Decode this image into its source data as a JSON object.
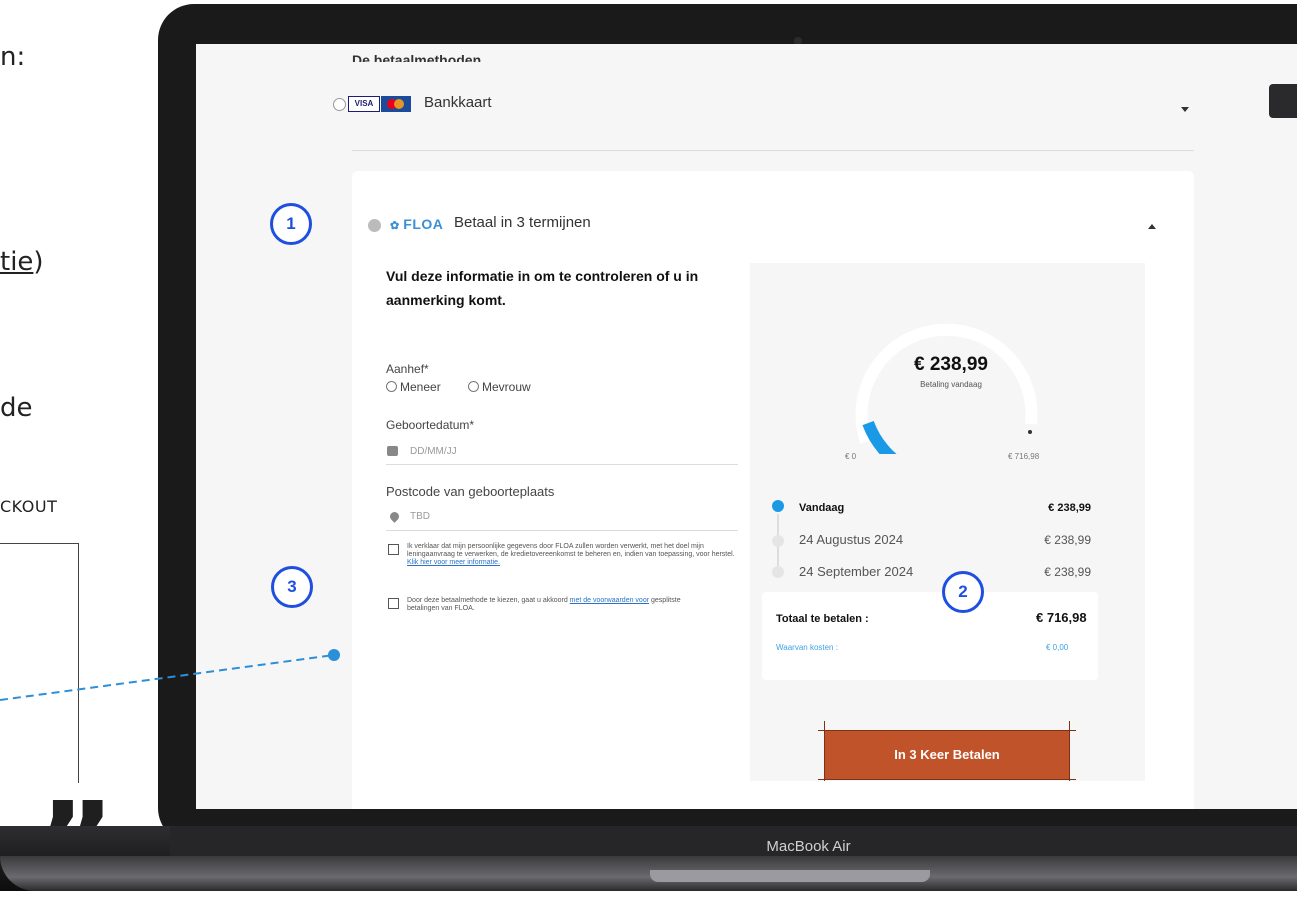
{
  "slide": {
    "line1": "n:",
    "line2_suffix": "tie",
    "line2_paren": ")",
    "line3": "de",
    "line4": "CKOUT",
    "quote": "”"
  },
  "laptop": {
    "model_label": "MacBook Air"
  },
  "checkout": {
    "header_cut": "De betaalmethoden",
    "bank_option": {
      "label": "Bankkaart",
      "visa_label": "VISA"
    },
    "floa_option": {
      "brand": "FLOA",
      "title": "Betaal in 3 termijnen",
      "form": {
        "intro": "Vul deze informatie in om te controleren of u in aanmerking komt.",
        "salutation_label": "Aanhef*",
        "salutation_options": [
          "Meneer",
          "Mevrouw"
        ],
        "birthdate_label": "Geboortedatum*",
        "birthdate_placeholder": "DD/MM/JJ",
        "postcode_label": "Postcode van geboorteplaats",
        "postcode_placeholder": "TBD",
        "consent1": "Ik verklaar dat mijn persoonlijke gegevens door FLOA zullen worden verwerkt, met het doel mijn leningaanvraag te verwerken, de kredietovereenkomst te beheren en, indien van toepassing, voor herstel.",
        "consent1_link": "Klik hier voor meer informatie.",
        "consent2": "Door deze betaalmethode te kiezen, gaat u akkoord",
        "consent2_link": "met de voorwaarden voor",
        "consent2_tail": "gesplitste betalingen van FLOA."
      },
      "summary": {
        "today_amount": "€ 238,99",
        "today_caption": "Betaling vandaag",
        "scale_min": "€ 0",
        "scale_max": "€ 716,98",
        "gauge_fraction": 0.333,
        "schedule": [
          {
            "date": "Vandaag",
            "amount": "€ 238,99"
          },
          {
            "date": "24 Augustus 2024",
            "amount": "€ 238,99"
          },
          {
            "date": "24 September 2024",
            "amount": "€ 238,99"
          }
        ],
        "total_label": "Totaal te betalen :",
        "total_amount": "€ 716,98",
        "fees_label": "Waarvan kosten :",
        "fees_amount": "€ 0,00",
        "pay_button": "In 3 Keer Betalen"
      }
    }
  },
  "callouts": {
    "one": "1",
    "two": "2",
    "three": "3"
  },
  "colors": {
    "accent": "#1f4fe0",
    "floa_blue": "#3ea2e5",
    "pay_button": "#c1532b"
  }
}
